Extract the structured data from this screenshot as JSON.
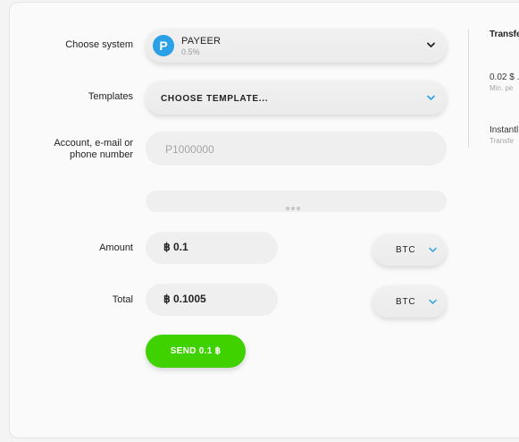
{
  "form": {
    "system": {
      "label": "Choose system",
      "name": "PAYEER",
      "fee": "0.5%",
      "logo_letter": "P",
      "logo_color": "#2aa0e6"
    },
    "templates": {
      "label": "Templates",
      "value": "CHOOSE TEMPLATE..."
    },
    "account": {
      "label_line1": "Account, e-mail or",
      "label_line2": "phone number",
      "placeholder": "P1000000"
    },
    "amount": {
      "label": "Amount",
      "value": "฿ 0.1",
      "currency": "BTC"
    },
    "total": {
      "label": "Total",
      "value": "฿ 0.1005",
      "currency": "BTC"
    },
    "send_label": "SEND 0.1 ฿",
    "send_color": "#3fd100",
    "chevron_accent": "#2aa0e6"
  },
  "side": {
    "title": "Transfe",
    "fee_value": "0.02 $ .",
    "fee_sub": "Min. pe",
    "time_value": "Instantl",
    "time_sub": "Transfe"
  }
}
